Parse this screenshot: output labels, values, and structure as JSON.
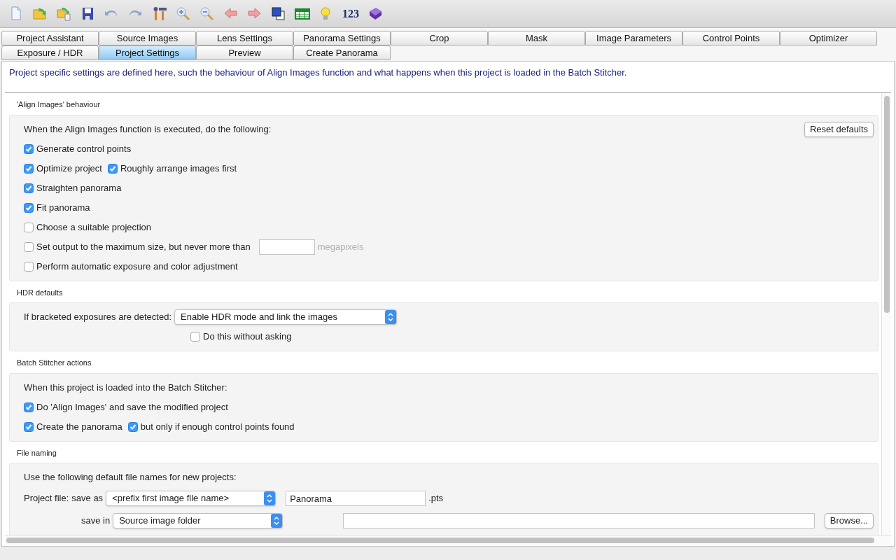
{
  "toolbar": [
    {
      "kind": "icon"
    },
    {
      "kind": "icon"
    },
    {
      "kind": "icon"
    },
    {
      "kind": "icon"
    },
    {
      "kind": "icon"
    },
    {
      "kind": "icon"
    },
    {
      "kind": "icon"
    },
    {
      "kind": "icon"
    },
    {
      "kind": "icon"
    },
    {
      "kind": "icon"
    },
    {
      "kind": "icon"
    },
    {
      "kind": "icon"
    },
    {
      "kind": "icon"
    },
    {
      "kind": "icon"
    },
    {
      "kind": "text",
      "text": "123"
    },
    {
      "kind": "icon"
    }
  ],
  "tab_rows": [
    [
      {
        "label": "Project Assistant",
        "selected": false
      },
      {
        "label": "Source Images",
        "selected": false
      },
      {
        "label": "Lens Settings",
        "selected": false
      },
      {
        "label": "Panorama Settings",
        "selected": false
      },
      {
        "label": "Crop",
        "selected": false
      },
      {
        "label": "Mask",
        "selected": false
      },
      {
        "label": "Image Parameters",
        "selected": false
      },
      {
        "label": "Control Points",
        "selected": false
      },
      {
        "label": "Optimizer",
        "selected": false
      }
    ],
    [
      {
        "label": "Exposure / HDR",
        "selected": false
      },
      {
        "label": "Project Settings",
        "selected": true
      },
      {
        "label": "Preview",
        "selected": false
      },
      {
        "label": "Create Panorama",
        "selected": false
      }
    ]
  ],
  "description": "Project specific settings are defined here, such the behaviour of Align Images function and what happens when this project is loaded in the Batch Stitcher.",
  "sections": [
    {
      "title": "'Align Images' behaviour",
      "rows": [
        {
          "kind": "plain",
          "items": [
            {
              "kind": "label",
              "text": "When the Align Images function is executed, do the following:"
            },
            {
              "kind": "button",
              "text": "Reset defaults"
            }
          ]
        },
        {
          "kind": "plain",
          "items": [
            {
              "kind": "checkbox",
              "label": "Generate control points",
              "checked": true
            }
          ]
        },
        {
          "kind": "plain",
          "items": [
            {
              "kind": "checkbox",
              "label": "Optimize project",
              "checked": true
            },
            {
              "kind": "checkbox",
              "label": "Roughly arrange images first",
              "checked": true
            }
          ]
        },
        {
          "kind": "plain",
          "items": [
            {
              "kind": "checkbox",
              "label": "Straighten panorama",
              "checked": true
            }
          ]
        },
        {
          "kind": "plain",
          "items": [
            {
              "kind": "checkbox",
              "label": "Fit panorama",
              "checked": true
            }
          ]
        },
        {
          "kind": "plain",
          "items": [
            {
              "kind": "checkbox",
              "label": "Choose a suitable projection",
              "checked": false
            }
          ]
        },
        {
          "kind": "plain",
          "items": [
            {
              "kind": "checkbox",
              "label": "Set output to the maximum size, but never more than",
              "checked": false
            },
            {
              "kind": "input"
            },
            {
              "kind": "unit",
              "text": "megapixels"
            }
          ]
        },
        {
          "kind": "plain",
          "items": [
            {
              "kind": "checkbox",
              "label": "Perform automatic exposure and color adjustment",
              "checked": false
            }
          ]
        }
      ]
    },
    {
      "title": "HDR defaults",
      "rows": [
        {
          "kind": "plain",
          "items": [
            {
              "kind": "label",
              "text": "If bracketed exposures are detected:"
            },
            {
              "kind": "select",
              "value": "Enable HDR mode and link the images"
            }
          ]
        },
        {
          "kind": "indented",
          "items": [
            {
              "kind": "checkbox",
              "label": "Do this without asking",
              "checked": false
            }
          ]
        }
      ]
    },
    {
      "title": "Batch Stitcher actions",
      "rows": [
        {
          "kind": "plain",
          "items": [
            {
              "kind": "label",
              "text": "When this project is loaded into the Batch Stitcher:"
            }
          ]
        },
        {
          "kind": "plain",
          "items": [
            {
              "kind": "checkbox",
              "label": "Do 'Align Images' and save the modified project",
              "checked": true
            }
          ]
        },
        {
          "kind": "plain",
          "items": [
            {
              "kind": "checkbox",
              "label": "Create the panorama",
              "checked": true
            },
            {
              "kind": "checkbox",
              "label": "but only if enough control points found",
              "checked": true
            }
          ]
        }
      ]
    },
    {
      "title": "File naming",
      "rows": [
        {
          "kind": "plain",
          "items": [
            {
              "kind": "label",
              "text": "Use the following default file names for new projects:"
            }
          ]
        },
        {
          "kind": "file",
          "items": [
            {
              "kind": "label",
              "text": "Project file:"
            },
            {
              "kind": "label",
              "text": "save as"
            },
            {
              "kind": "select",
              "value": "<prefix first image file name>"
            },
            {
              "kind": "input",
              "value": "Panorama"
            },
            {
              "kind": "label",
              "text": ".pts"
            }
          ]
        },
        {
          "kind": "file",
          "items": [
            {
              "kind": "label",
              "text": "save in"
            },
            {
              "kind": "select",
              "value": "Source image folder"
            },
            {
              "kind": "input"
            },
            {
              "kind": "button",
              "text": "Browse..."
            }
          ]
        }
      ]
    }
  ]
}
